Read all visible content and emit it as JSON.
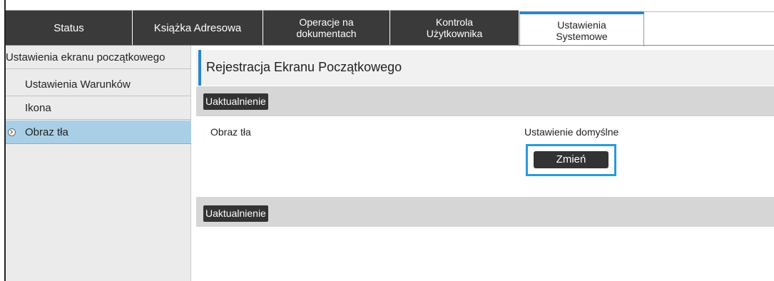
{
  "tabs": [
    {
      "label": "Status"
    },
    {
      "label": "Książka Adresowa"
    },
    {
      "label": "Operacje na\ndokumentach"
    },
    {
      "label": "Kontrola\nUżytkownika"
    },
    {
      "label": "Ustawienia\nSystemowe",
      "active": true
    }
  ],
  "sidebar": {
    "header": "Ustawienia ekranu początkowego",
    "items": [
      {
        "label": "Ustawienia Warunków"
      },
      {
        "label": "Ikona"
      },
      {
        "label": "Obraz tła",
        "selected": true
      }
    ]
  },
  "main": {
    "title": "Rejestracja Ekranu Początkowego",
    "update_top": "Uaktualnienie",
    "update_bottom": "Uaktualnienie",
    "field_label": "Obraz tła",
    "field_value": "Ustawienie domyślne",
    "change_button": "Zmień"
  },
  "colors": {
    "accent": "#2a86c8",
    "highlight_border": "#2a9bd8",
    "selected_item": "#a9cfe6",
    "tab_dark": "#3a3a3a"
  }
}
